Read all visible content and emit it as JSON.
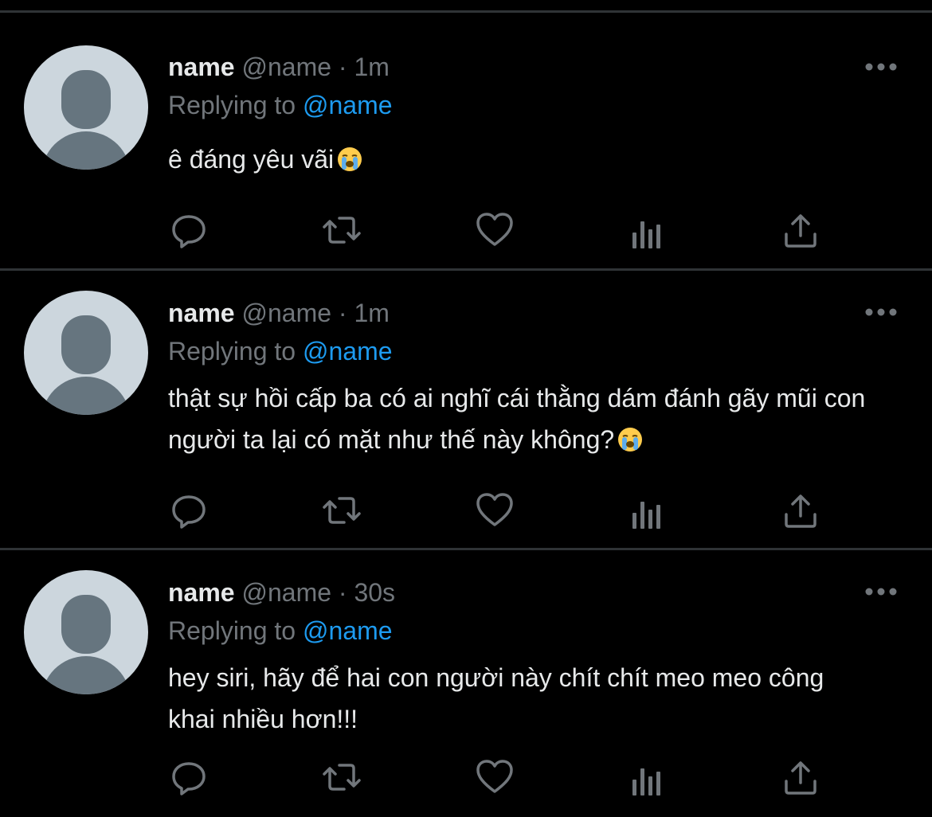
{
  "tweets": [
    {
      "display_name": "name",
      "handle": "@name",
      "separator": "·",
      "time": "1m",
      "reply_prefix": "Replying to",
      "reply_to": "@name",
      "text": "ê đáng yêu vãi",
      "emoji": "loudly-crying-face"
    },
    {
      "display_name": "name",
      "handle": "@name",
      "separator": "·",
      "time": "1m",
      "reply_prefix": "Replying to",
      "reply_to": "@name",
      "text": "thật sự hồi cấp ba có ai nghĩ cái thằng dám đánh gãy mũi con người ta lại có mặt như thế này không?",
      "emoji": "loudly-crying-face"
    },
    {
      "display_name": "name",
      "handle": "@name",
      "separator": "·",
      "time": "30s",
      "reply_prefix": "Replying to",
      "reply_to": "@name",
      "text": "hey siri, hãy để hai con người này chít chít meo meo công khai nhiều hơn!!!",
      "emoji": ""
    }
  ],
  "actions": [
    "reply-icon",
    "retweet-icon",
    "like-icon",
    "analytics-icon",
    "share-icon"
  ],
  "colors": {
    "background": "#000000",
    "divider": "#2f3336",
    "primary_text": "#e7e9ea",
    "secondary_text": "#71767b",
    "link": "#1d9bf0",
    "avatar_bg": "#ccd6dd",
    "avatar_fg": "#66757f"
  }
}
